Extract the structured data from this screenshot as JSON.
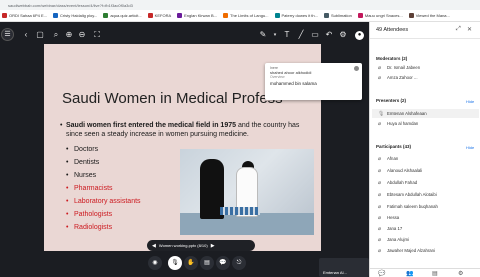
{
  "browser": {
    "url": "saudiwebbab.com/webinar/class/event/lesson/4/live?f=fb1f3ac0f0a3d3",
    "bookmarks": [
      "ORDI Sahaa 6P4 E...",
      "Cristy Haidalig ploy...",
      "aqua.quiz.articit...",
      "KEFORA",
      "Englan   Kirwan B...",
      "The Limits of Langu...",
      "Paterry dowes it th...",
      "Sublimation",
      "Mauu ungri Snaces...",
      "Viewed the Mana..."
    ]
  },
  "toolbar": {
    "left_icons": [
      "menu-icon",
      "back-icon",
      "search-icon",
      "zoom-in-icon",
      "zoom-out-icon",
      "fit-icon"
    ],
    "right_icons": [
      "pen-icon",
      "color-dropdown-icon",
      "text-icon",
      "line-icon",
      "shape-icon",
      "undo-icon",
      "settings-icon",
      "record-icon"
    ]
  },
  "slide": {
    "title": "Saudi Women in Medical Profess",
    "body_lead": "Saudi women first entered the medical field in 1975",
    "body_rest": " and the country has since seen a steady increase in women pursuing medicine.",
    "bullets_black": [
      "Doctors",
      "Dentists",
      "Nurses"
    ],
    "bullets_red": [
      "Pharmacists",
      "Laboratory assistants",
      "Pathologists",
      "Radiologists"
    ],
    "red_color": "#cc1a20"
  },
  "pager": {
    "label": "Women working.pptx (8/10)"
  },
  "self_tile": {
    "name": "Emtenan Al..."
  },
  "popup": {
    "line1": "Inere",
    "line2": "shahed ahoor alkhodidi",
    "line3": "Overview",
    "line4": "mohammed bin salama"
  },
  "sidebar": {
    "title": "49 Attendees",
    "moderators_label": "Moderators (2)",
    "moderators": [
      "Dr. Ismail Jabeen",
      "Amza Zahoor ..."
    ],
    "presenters_label": "Presenters (2)",
    "presenters_link": "Hide",
    "presenters": [
      "Emtenan Alshafeaan",
      "Huya al hamdan"
    ],
    "participants_label": "Participants (43)",
    "participants_link": "Hide",
    "participants": [
      "Afnan",
      "Alanoud Alshaalali",
      "Abdullah Fahad",
      "Ebtesam Abdullah Alotaibi",
      "Fatimah saleem buqhanah",
      "Hessa",
      "Jana 17",
      "Jana Alujmi",
      "Jawaher Majed Alzahrani"
    ]
  },
  "colors": {
    "accent": "#1a73e8",
    "stage_bg": "#1b1d22",
    "slide_bg": "#ead7d4"
  }
}
